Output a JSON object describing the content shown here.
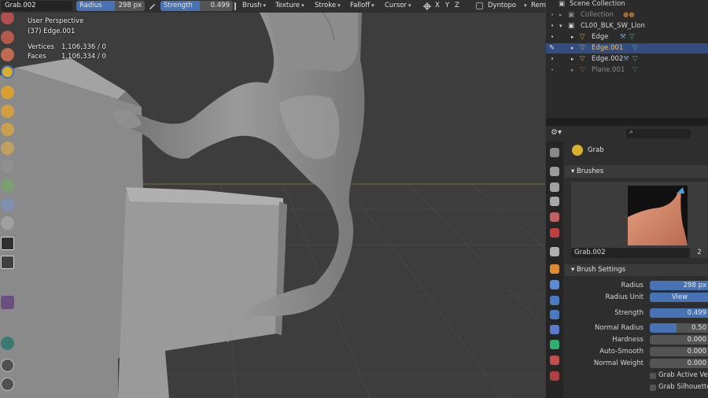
{
  "header": {
    "tool_name": "Grab.002",
    "radius_label": "Radius",
    "radius_value": "298 px",
    "strength_label": "Strength",
    "strength_value": "0.499",
    "menus": [
      "Brush",
      "Texture",
      "Stroke",
      "Falloff",
      "Cursor"
    ],
    "axes": [
      "X",
      "Y",
      "Z"
    ],
    "dyntopo_label": "Dyntopo",
    "remesh_label": "Rem"
  },
  "viewport": {
    "view_name": "User Perspective",
    "object_name": "(37) Edge.001",
    "stats": [
      {
        "label": "Vertices",
        "value": "1,106,336 / 0"
      },
      {
        "label": "Faces",
        "value": "1,106,334 / 0"
      }
    ]
  },
  "outliner": {
    "scene_collection": "Scene Collection",
    "items": [
      {
        "label": "Collection",
        "dim": true
      },
      {
        "label": "CL00_BLK_SW_Llon",
        "dim": false
      },
      {
        "label": "Edge",
        "dim": false
      },
      {
        "label": "Edge.001",
        "dim": false,
        "selected": true
      },
      {
        "label": "Edge.002",
        "dim": false
      },
      {
        "label": "Plane.001",
        "dim": true
      }
    ]
  },
  "properties": {
    "tool_title": "Grab",
    "brushes_header": "Brushes",
    "brush_name": "Grab.002",
    "brush_users": "2",
    "brush_settings_header": "Brush Settings",
    "settings": [
      {
        "label": "Radius",
        "value": "298 px",
        "style": "blue"
      },
      {
        "label": "Radius Unit",
        "value": "View",
        "style": "blue-center"
      },
      {
        "label": "Strength",
        "value": "0.499",
        "style": "blue"
      },
      {
        "label": "Normal Radius",
        "value": "0.50",
        "style": "partial"
      },
      {
        "label": "Hardness",
        "value": "0.000",
        "style": "plain"
      },
      {
        "label": "Auto-Smooth",
        "value": "0.000",
        "style": "plain"
      },
      {
        "label": "Normal Weight",
        "value": "0.000",
        "style": "plain"
      }
    ],
    "checkboxes": [
      "Grab Active Verte",
      "Grab Silhouette"
    ]
  },
  "colors": {
    "accent_blue": "#4772b3",
    "selected_row": "#334d80",
    "mesh_gray": "#8c8c8c",
    "active_orange": "#e8a03a"
  }
}
